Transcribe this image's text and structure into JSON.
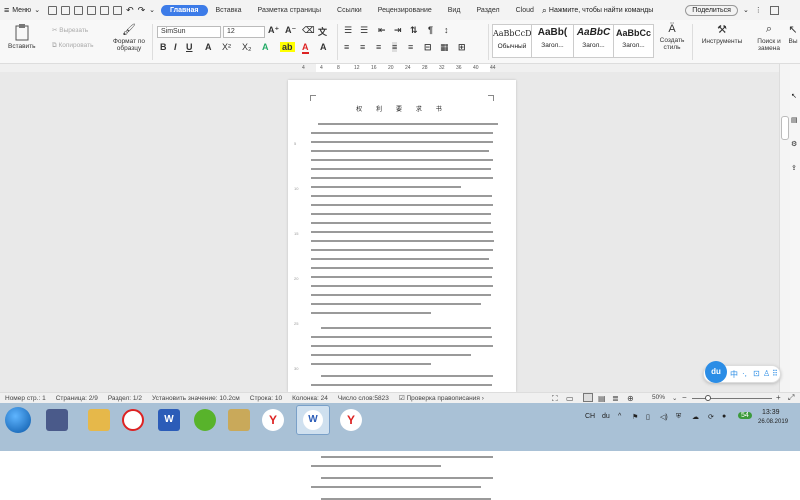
{
  "menubar": {
    "menu_label": "Меню",
    "tabs": [
      {
        "label": "Главная",
        "active": true
      },
      {
        "label": "Вставка"
      },
      {
        "label": "Разметка страницы"
      },
      {
        "label": "Ссылки"
      },
      {
        "label": "Рецензирование"
      },
      {
        "label": "Вид"
      },
      {
        "label": "Раздел"
      },
      {
        "label": "Cloud"
      }
    ],
    "search_text": "Нажмите, чтобы найти команды",
    "share_label": "Поделиться"
  },
  "ribbon": {
    "paste": "Вставить",
    "cut": "Вырезать",
    "copy": "Копировать",
    "format_painter": "Формат по образцу",
    "font_name": "SimSun",
    "font_size": "12",
    "styles": [
      {
        "preview": "AaBbCcDd",
        "name": "Обычный"
      },
      {
        "preview": "AaBb(",
        "name": "Загол..."
      },
      {
        "preview": "AaBbC",
        "name": "Загол..."
      },
      {
        "preview": "AaBbCc",
        "name": "Загол..."
      }
    ],
    "create_style": "Создать стиль",
    "tools": "Инструменты",
    "find_replace": "Поиск и замена",
    "select": "Вы"
  },
  "ruler": {
    "ticks": [
      "4",
      "4",
      "8",
      "12",
      "16",
      "20",
      "24",
      "28",
      "32",
      "36",
      "40",
      "44"
    ]
  },
  "document": {
    "title": "权 利 要 求 书",
    "line_numbers": [
      "5",
      "10",
      "15",
      "20",
      "25",
      "30"
    ]
  },
  "statusbar": {
    "page_number": "Номер стр.: 1",
    "page": "Страница: 2/9",
    "section": "Раздел: 1/2",
    "setting": "Установить значение: 10.2см",
    "line": "Строка: 10",
    "column": "Колонка: 24",
    "word_count": "Число слов:5823",
    "spellcheck": "Проверка правописания",
    "zoom": "50%"
  },
  "taskbar": {
    "lang": "CH",
    "time": "13:39",
    "date": "26.08.2019",
    "badge": "54"
  },
  "float_toolbar": {
    "label": "中"
  }
}
